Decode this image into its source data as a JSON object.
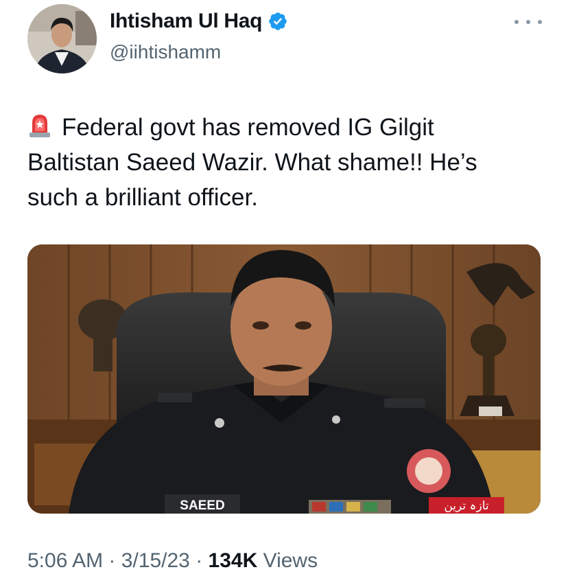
{
  "author": {
    "display_name": "Ihtisham Ul Haq",
    "handle": "@iihtishamm",
    "verified": true,
    "verified_color": "#1d9bf0"
  },
  "tweet": {
    "text_line1": "Federal govt has removed IG Gilgit",
    "text_line2": "Baltistan Saeed Wazir. What shame!!  He’s",
    "text_line3": "such a brilliant officer.",
    "leading_emoji": "police-car-light-icon"
  },
  "media": {
    "name_tag": "SAEED",
    "urdu_tag": "تازہ ترین"
  },
  "meta": {
    "time": "5:06 AM",
    "separator": "·",
    "date": "3/15/23",
    "views_count": "134K",
    "views_label": "Views"
  },
  "icons": {
    "more": "more-horizontal-icon",
    "verified": "verified-badge-icon"
  }
}
